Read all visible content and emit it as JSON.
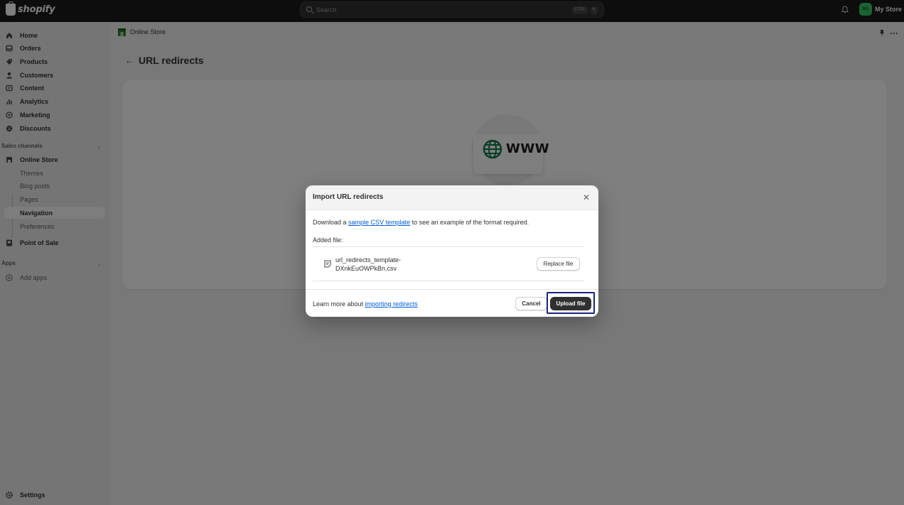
{
  "topbar": {
    "brand": "shopify",
    "search_placeholder": "Search",
    "kbd_ctrl": "CTRL",
    "kbd_k": "K",
    "avatar_initials": "MS",
    "store_name": "My Store"
  },
  "sidebar": {
    "items": [
      {
        "label": "Home",
        "icon": "home-icon"
      },
      {
        "label": "Orders",
        "icon": "orders-icon"
      },
      {
        "label": "Products",
        "icon": "tag-icon"
      },
      {
        "label": "Customers",
        "icon": "person-icon"
      },
      {
        "label": "Content",
        "icon": "content-icon"
      },
      {
        "label": "Analytics",
        "icon": "bar-chart-icon"
      },
      {
        "label": "Marketing",
        "icon": "target-icon"
      },
      {
        "label": "Discounts",
        "icon": "discount-icon"
      }
    ],
    "sales_channels_label": "Sales channels",
    "online_store": "Online Store",
    "online_store_sub": [
      "Themes",
      "Blog posts",
      "Pages",
      "Navigation",
      "Preferences"
    ],
    "point_of_sale": "Point of Sale",
    "apps_label": "Apps",
    "add_apps": "Add apps",
    "settings": "Settings"
  },
  "main": {
    "breadcrumb": "Online Store",
    "page_title": "URL redirects",
    "illustration_text": "WWW"
  },
  "modal": {
    "title": "Import URL redirects",
    "desc_prefix": "Download a ",
    "desc_link": "sample CSV template",
    "desc_suffix": " to see an example of the format required.",
    "added_label": "Added file:",
    "file_line1": "url_redirects_template-",
    "file_line2": "DXnkEuOWPkBn.csv",
    "replace_label": "Replace file",
    "learn_prefix": "Learn more about ",
    "learn_link": "importing redirects",
    "cancel_label": "Cancel",
    "upload_label": "Upload file"
  },
  "colors": {
    "topbar": "#1a1a1a",
    "link": "#005bd3",
    "primary_button": "#303030",
    "highlight": "#1a237e",
    "avatar": "#32c864",
    "globe": "#0b7a4b"
  }
}
